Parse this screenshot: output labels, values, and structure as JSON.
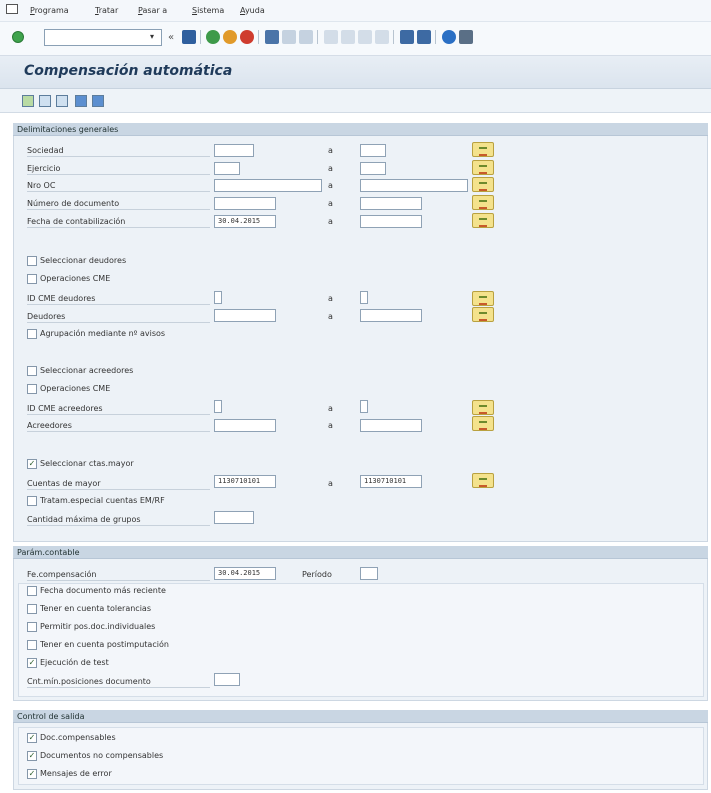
{
  "menu": {
    "items": [
      "Programa",
      "Tratar",
      "Pasar a",
      "Sistema",
      "Ayuda"
    ]
  },
  "toolbar": {
    "command_value": ""
  },
  "title": "Compensación automática",
  "colors": {
    "title": "#1f3a5a",
    "group_header": "#c9d6e3",
    "multisel": "#f4e28c"
  },
  "icons": {
    "app_toolbar": [
      "execute-icon",
      "variant-icon",
      "get-variant-icon",
      "info-icon",
      "info-icon"
    ],
    "toolbar": [
      "enter-icon",
      "save-icon",
      "back-icon",
      "exit-icon",
      "cancel-icon",
      "print-icon",
      "find-icon",
      "find-next-icon",
      "first-page-icon",
      "prev-page-icon",
      "next-page-icon",
      "last-page-icon",
      "create-session-icon",
      "shortcut-icon",
      "help-icon",
      "layout-icon"
    ]
  },
  "delimitaciones": {
    "header": "Delimitaciones generales",
    "a_label": "a",
    "rows": [
      {
        "label": "Sociedad",
        "from": "",
        "to": ""
      },
      {
        "label": "Ejercicio",
        "from": "",
        "to": ""
      },
      {
        "label": "Nro OC",
        "from": "",
        "to": ""
      },
      {
        "label": "Número de documento",
        "from": "",
        "to": ""
      },
      {
        "label": "Fecha de contabilización",
        "from": "30.04.2015",
        "to": ""
      }
    ],
    "deudores": {
      "select_label": "Seleccionar deudores",
      "select_checked": false,
      "cme_label": "Operaciones CME",
      "cme_checked": false,
      "cme_id_label": "ID CME deudores",
      "cme_id_from": "",
      "cme_id_to": "",
      "label": "Deudores",
      "from": "",
      "to": "",
      "agrup_label": "Agrupación mediante nº avisos",
      "agrup_checked": false
    },
    "acreedores": {
      "select_label": "Seleccionar acreedores",
      "select_checked": false,
      "cme_label": "Operaciones CME",
      "cme_checked": false,
      "cme_id_label": "ID CME acreedores",
      "cme_id_from": "",
      "cme_id_to": "",
      "label": "Acreedores",
      "from": "",
      "to": ""
    },
    "mayor": {
      "select_label": "Seleccionar ctas.mayor",
      "select_checked": true,
      "cuentas_label": "Cuentas de mayor",
      "cuentas_from": "1130710101",
      "cuentas_to": "1130710101",
      "trat_label": "Tratam.especial cuentas EM/RF",
      "trat_checked": false,
      "max_label": "Cantidad máxima de grupos",
      "max_value": ""
    }
  },
  "param": {
    "header": "Parám.contable",
    "fecha_label": "Fe.compensación",
    "fecha_value": "30.04.2015",
    "periodo_label": "Período",
    "periodo_value": "",
    "checks": [
      {
        "label": "Fecha documento más reciente",
        "checked": false
      },
      {
        "label": "Tener en cuenta tolerancias",
        "checked": false
      },
      {
        "label": "Permitir pos.doc.individuales",
        "checked": false
      },
      {
        "label": "Tener en cuenta postimputación",
        "checked": false
      },
      {
        "label": "Ejecución de test",
        "checked": true
      }
    ],
    "cnt_label": "Cnt.mín.posiciones documento",
    "cnt_value": ""
  },
  "control": {
    "header": "Control de salida",
    "checks": [
      {
        "label": "Doc.compensables",
        "checked": true
      },
      {
        "label": "Documentos no compensables",
        "checked": true
      },
      {
        "label": "Mensajes de error",
        "checked": true
      }
    ]
  }
}
